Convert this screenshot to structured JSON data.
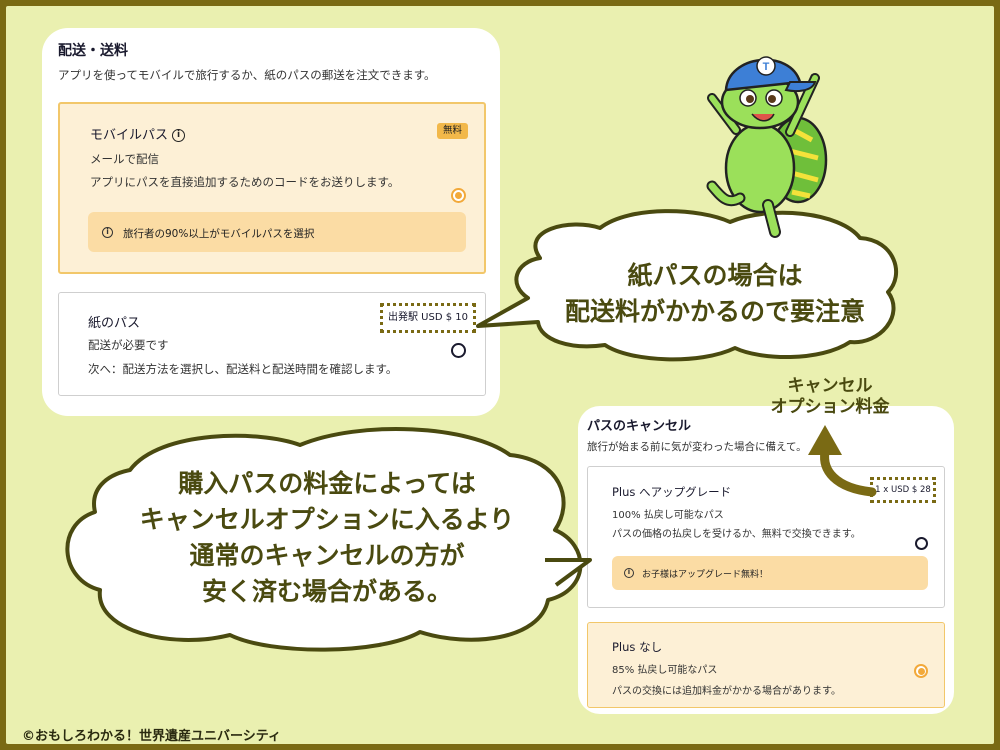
{
  "shipping": {
    "title": "配送・送料",
    "subtitle": "アプリを使ってモバイルで旅行するか、紙のパスの郵送を注文できます。",
    "mobile_pass": {
      "title": "モバイルパス",
      "badge": "無料",
      "line1": "メールで配信",
      "line2": "アプリにパスを直接追加するためのコードをお送りします。",
      "notice": "旅行者の90%以上がモバイルパスを選択",
      "selected": true
    },
    "paper_pass": {
      "title": "紙のパス",
      "price": "出発駅 USD $ 10",
      "line1": "配送が必要です",
      "line2": "次へ：配送方法を選択し、配送料と配送時間を確認します。",
      "selected": false
    }
  },
  "cancellation": {
    "title": "パスのキャンセル",
    "subtitle": "旅行が始まる前に気が変わった場合に備えて。",
    "plus_upgrade": {
      "title": "Plus へアップグレード",
      "price": "1 x USD $ 28",
      "line1": "100% 払戻し可能なパス",
      "line2": "パスの価格の払戻しを受けるか、無料で交換できます。",
      "notice": "お子様はアップグレード無料！",
      "selected": false
    },
    "plus_none": {
      "title": "Plus なし",
      "line1": "85% 払戻し可能なパス",
      "line2": "パスの交換には追加料金がかかる場合があります。",
      "selected": true
    }
  },
  "bubbles": {
    "paper_note": [
      "紙パスの場合は",
      "配送料がかかるので要注意"
    ],
    "cancel_note": [
      "購入パスの料金によっては",
      "キャンセルオプションに入るより",
      "通常のキャンセルの方が",
      "安く済む場合がある。"
    ]
  },
  "annotation": [
    "キャンセル",
    "オプション料金"
  ],
  "copyright": "©おもしろわかる！世界遺産ユニバーシティ",
  "colors": {
    "border": "#7a6a14",
    "background": "#eaf0b0",
    "accent": "#f2a93a",
    "notice_bg": "#fbdca4"
  },
  "icons": [
    "info-icon",
    "radio-selected-icon",
    "radio-empty-icon",
    "frog-mascot",
    "curved-arrow-icon"
  ]
}
